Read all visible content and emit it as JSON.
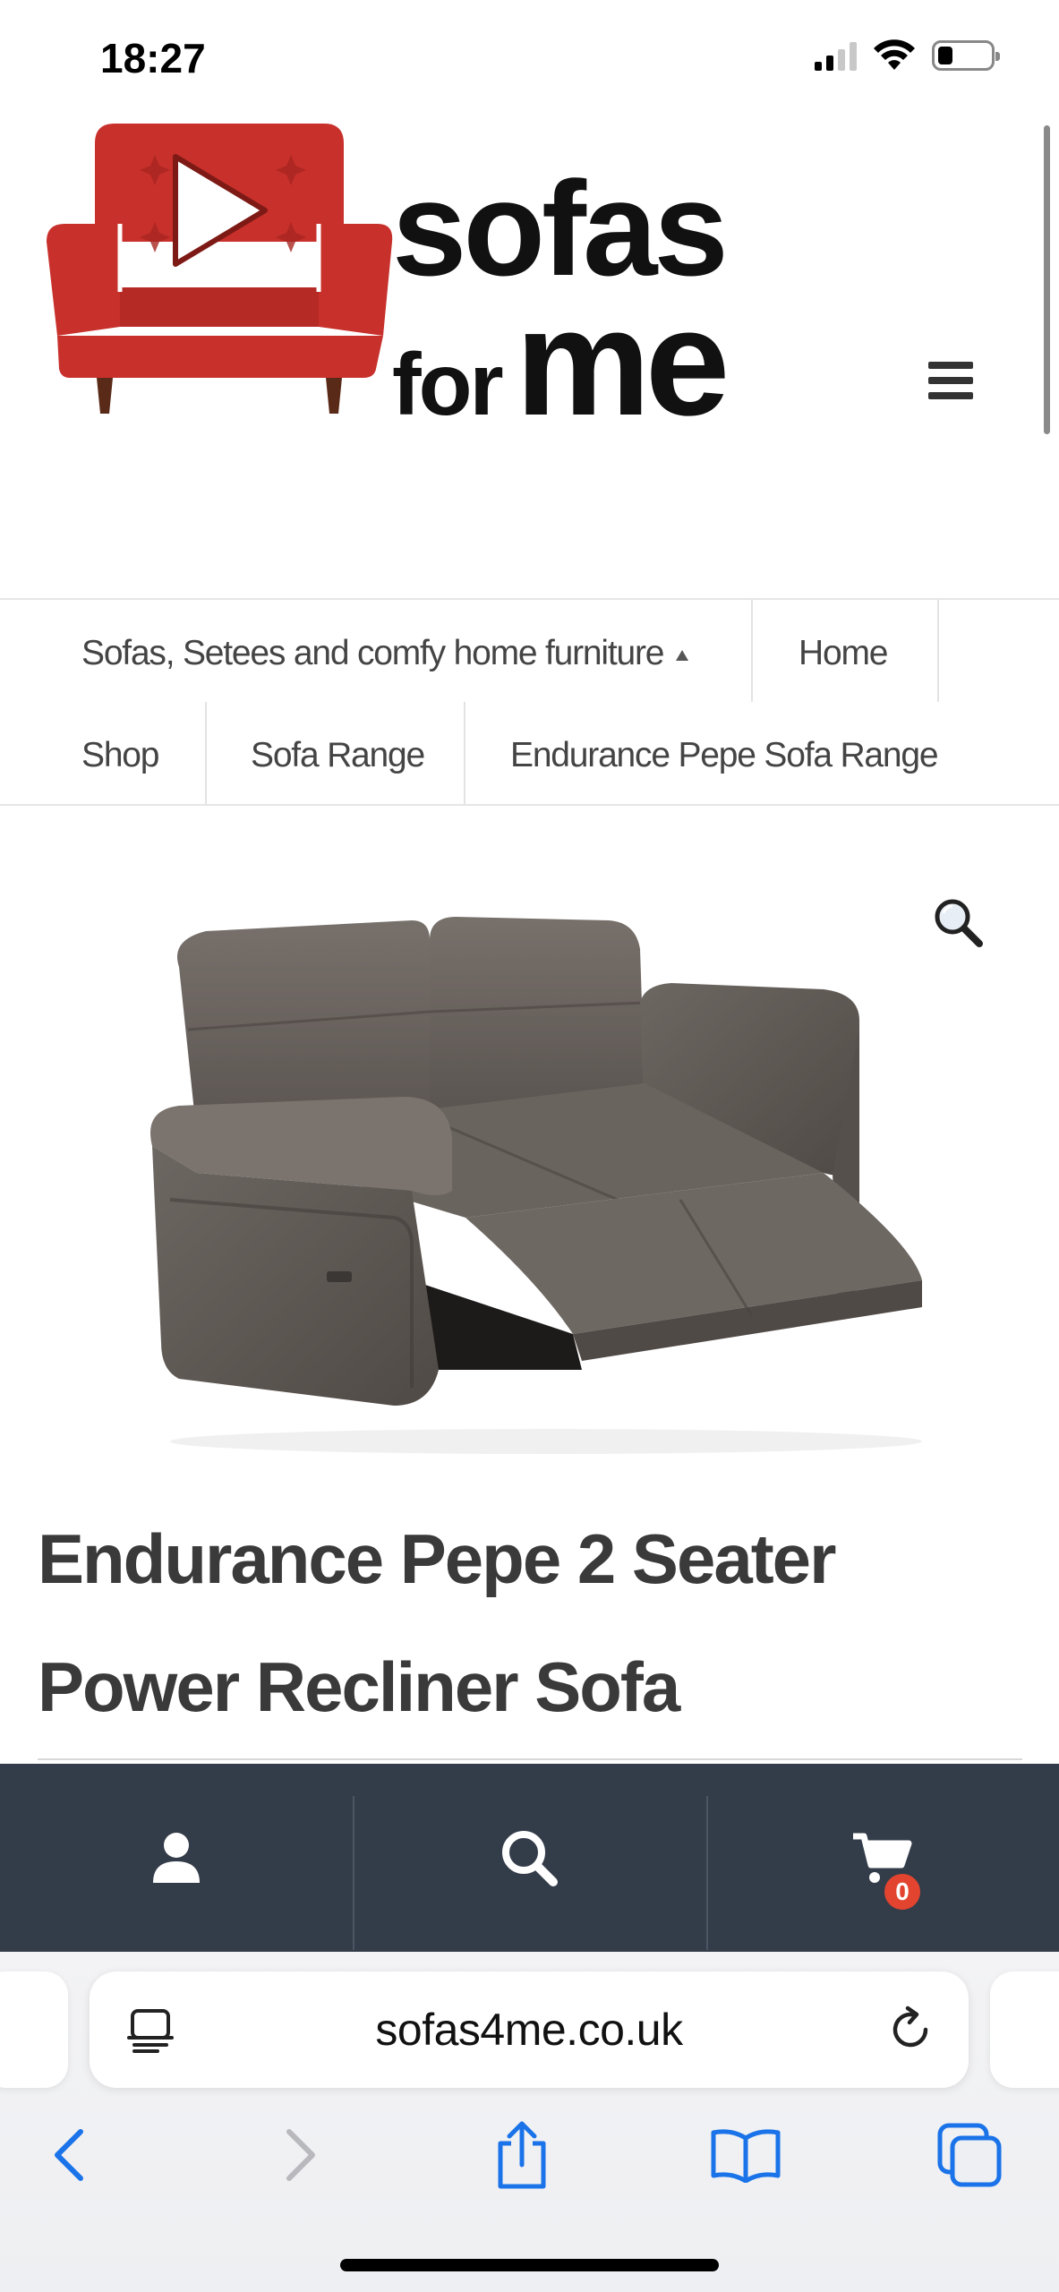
{
  "status_bar": {
    "time": "18:27",
    "icons": [
      "cellular-signal-icon",
      "wifi-icon",
      "battery-icon"
    ]
  },
  "header": {
    "logo": {
      "line1": "sofas",
      "line2_small": "for",
      "line2_large": "me"
    },
    "menu_icon": "hamburger-menu-icon"
  },
  "breadcrumb": {
    "items": [
      {
        "label": "Sofas, Setees and comfy home furniture",
        "has_dropdown": true
      },
      {
        "label": "Home"
      },
      {
        "label": "Shop"
      },
      {
        "label": "Sofa Range"
      },
      {
        "label": "Endurance Pepe Sofa Range"
      }
    ]
  },
  "product": {
    "image_alt": "Grey 2 seater power recliner sofa",
    "zoom_icon": "magnifier-icon",
    "title": "Endurance Pepe 2 Seater Power Recliner Sofa"
  },
  "action_bar": {
    "items": [
      {
        "icon": "user-icon"
      },
      {
        "icon": "search-icon"
      },
      {
        "icon": "cart-icon",
        "badge": "0"
      }
    ]
  },
  "browser": {
    "url": "sofas4me.co.uk",
    "reader_icon": "reader-mode-icon",
    "reload_icon": "reload-icon",
    "toolbar": [
      "back-icon",
      "forward-icon",
      "share-icon",
      "bookmarks-icon",
      "tabs-icon"
    ]
  },
  "colors": {
    "brand_red": "#c8302b",
    "footer_bar": "#333c49",
    "badge": "#e2442f",
    "ios_blue": "#1a73e8"
  }
}
